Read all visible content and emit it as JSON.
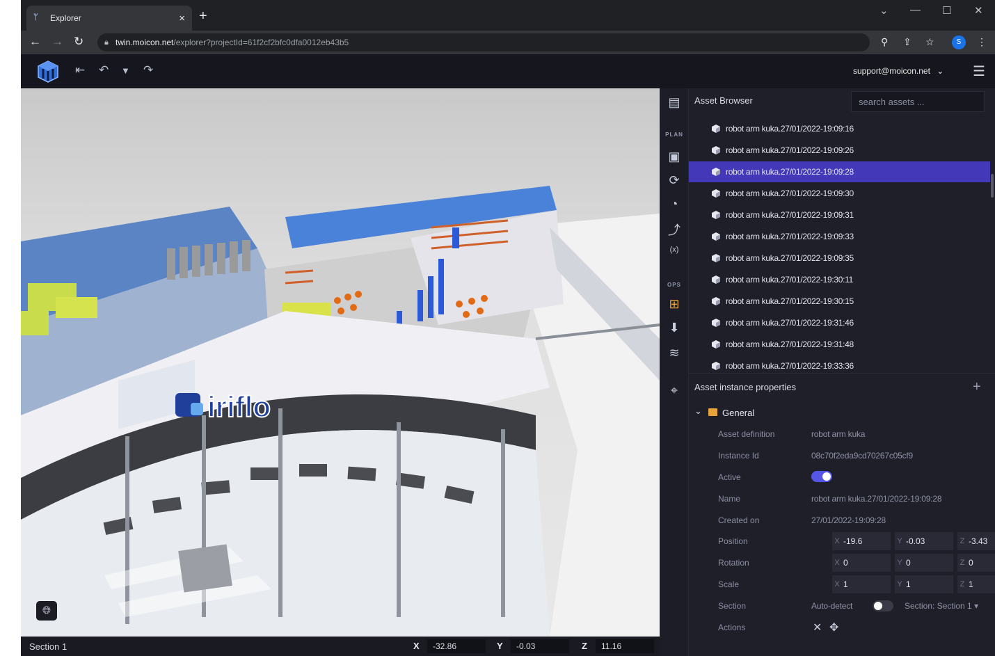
{
  "browser": {
    "tab_title": "Explorer",
    "tab_close": "×",
    "new_tab": "+",
    "url_host": "twin.moicon.net",
    "url_path": "/explorer?projectId=61f2cf2bfc0dfa0012eb43b5",
    "profile_initial": "S",
    "window_controls": {
      "chevron": "⌄",
      "minimize": "—",
      "maximize": "☐",
      "close": "✕"
    }
  },
  "app": {
    "user_email": "support@moicon.net",
    "user_chevron": "⌄",
    "toolbar_icons": [
      "exit-icon",
      "undo-icon",
      "dropdown-icon",
      "redo-icon"
    ]
  },
  "viewport": {
    "logo_text": "iriflo",
    "section_label": "Section 1",
    "coords": {
      "x_label": "X",
      "x_value": "-32.86",
      "y_label": "Y",
      "y_value": "-0.03",
      "z_label": "Z",
      "z_value": "11.16"
    }
  },
  "rail": {
    "plan_label": "PLAN",
    "ops_label": "OPS"
  },
  "asset_browser": {
    "title": "Asset Browser",
    "search_placeholder": "search assets ...",
    "items": [
      "robot arm kuka.27/01/2022-19:09:16",
      "robot arm kuka.27/01/2022-19:09:26",
      "robot arm kuka.27/01/2022-19:09:28",
      "robot arm kuka.27/01/2022-19:09:30",
      "robot arm kuka.27/01/2022-19:09:31",
      "robot arm kuka.27/01/2022-19:09:33",
      "robot arm kuka.27/01/2022-19:09:35",
      "robot arm kuka.27/01/2022-19:30:11",
      "robot arm kuka.27/01/2022-19:30:15",
      "robot arm kuka.27/01/2022-19:31:46",
      "robot arm kuka.27/01/2022-19:31:48",
      "robot arm kuka.27/01/2022-19:33:36"
    ],
    "selected_index": 2
  },
  "properties": {
    "title": "Asset instance properties",
    "add": "+",
    "group": "General",
    "asset_definition_label": "Asset definition",
    "asset_definition_value": "robot arm kuka",
    "instance_id_label": "Instance Id",
    "instance_id_value": "08c70f2eda9cd70267c05cf9",
    "active_label": "Active",
    "active": true,
    "name_label": "Name",
    "name_value": "robot arm kuka.27/01/2022-19:09:28",
    "created_label": "Created on",
    "created_value": "27/01/2022-19:09:28",
    "position_label": "Position",
    "position": {
      "x": "-19.6",
      "y": "-0.03",
      "z": "-3.43"
    },
    "rotation_label": "Rotation",
    "rotation": {
      "x": "0",
      "y": "0",
      "z": "0"
    },
    "scale_label": "Scale",
    "scale": {
      "x": "1",
      "y": "1",
      "z": "1"
    },
    "section_label": "Section",
    "auto_detect_label": "Auto-detect",
    "auto_detect": false,
    "section_dropdown": "Section: Section 1",
    "actions_label": "Actions",
    "axis_x": "X",
    "axis_y": "Y",
    "axis_z": "Z"
  },
  "colors": {
    "accent": "#4338b8",
    "toggle": "#5656e6",
    "panel": "#1f1f29",
    "topbar": "#16161e"
  }
}
